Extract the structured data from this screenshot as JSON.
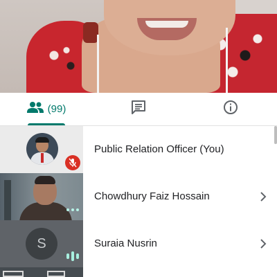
{
  "tabs": {
    "people": {
      "icon": "people-icon",
      "label": "(99)"
    },
    "chat": {
      "icon": "chat-icon"
    },
    "info": {
      "icon": "info-icon"
    },
    "active": "people",
    "accent_color": "#00796b"
  },
  "participants": [
    {
      "name": "Public Relation Officer (You)",
      "muted": true,
      "avatar": "photo"
    },
    {
      "name": "Chowdhury Faiz Hossain",
      "status": "more-dots",
      "avatar": "video"
    },
    {
      "name": "Suraia Nusrin",
      "initial": "S",
      "status": "speaking",
      "avatar": "initial"
    }
  ],
  "colors": {
    "mute_badge": "#d93025",
    "speaking_indicator": "#a8f0df"
  }
}
